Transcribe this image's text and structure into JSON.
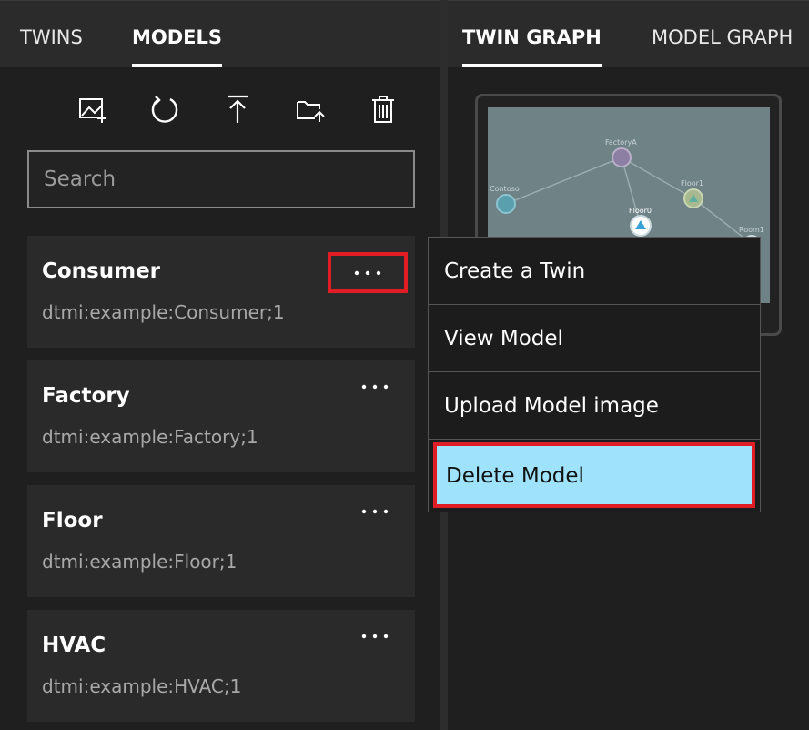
{
  "left_tabs": [
    {
      "label": "TWINS",
      "active": false
    },
    {
      "label": "MODELS",
      "active": true
    }
  ],
  "right_tabs": [
    {
      "label": "TWIN GRAPH",
      "active": true
    },
    {
      "label": "MODEL GRAPH",
      "active": false
    }
  ],
  "toolbar": [
    {
      "icon": "upload-image-icon"
    },
    {
      "icon": "refresh-icon"
    },
    {
      "icon": "upload-icon"
    },
    {
      "icon": "upload-folder-icon"
    },
    {
      "icon": "trash-icon"
    }
  ],
  "search": {
    "placeholder": "Search",
    "value": ""
  },
  "models": [
    {
      "name": "Consumer",
      "id": "dtmi:example:Consumer;1"
    },
    {
      "name": "Factory",
      "id": "dtmi:example:Factory;1"
    },
    {
      "name": "Floor",
      "id": "dtmi:example:Floor;1"
    },
    {
      "name": "HVAC",
      "id": "dtmi:example:HVAC;1"
    }
  ],
  "context_menu": {
    "items": [
      {
        "label": "Create a Twin"
      },
      {
        "label": "View Model"
      },
      {
        "label": "Upload Model image"
      },
      {
        "label": "Delete Model"
      }
    ]
  },
  "graph_preview": {
    "nodes": [
      "FactoryA",
      "Contoso",
      "Floor1",
      "Floor0",
      "Room1"
    ]
  },
  "colors": {
    "highlight_border": "#e01c24",
    "menu_highlight_bg": "#9ee3fb",
    "panel_bg": "#1f1f1f"
  }
}
